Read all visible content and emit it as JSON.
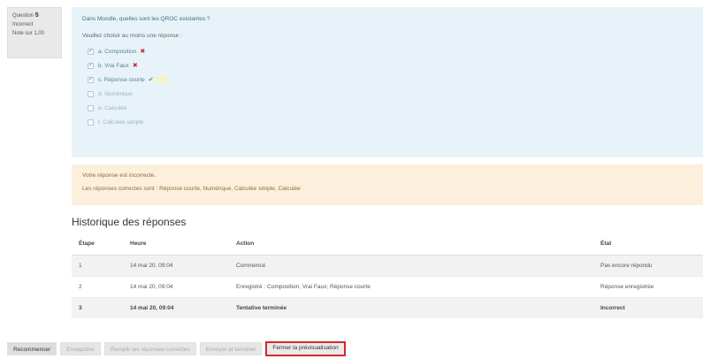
{
  "question_info": {
    "number_label": "Question",
    "number": "5",
    "status": "Incorrect",
    "mark": "Note sur 1,00"
  },
  "formulation": {
    "question_text": "Dans Moodle, quelles sont les QROC existantes ?",
    "prompt": "Veuillez choisir au moins une réponse :",
    "answers": [
      {
        "label": "a. Composition",
        "checked": true,
        "mark": "✖"
      },
      {
        "label": "b. Vrai Faux",
        "checked": true,
        "mark": "✖"
      },
      {
        "label": "c. Réponse courte",
        "checked": true,
        "mark": "✔"
      },
      {
        "label": "d. Numérique",
        "checked": false,
        "mark": ""
      },
      {
        "label": "e. Calculée",
        "checked": false,
        "mark": ""
      },
      {
        "label": "f. Calculée simple",
        "checked": false,
        "mark": ""
      }
    ]
  },
  "feedback": {
    "status": "Votre réponse est incorrecte.",
    "correct": "Les réponses correctes sont : Réponse courte, Numérique, Calculée simple, Calculée"
  },
  "history": {
    "title": "Historique des réponses",
    "headers": [
      "Étape",
      "Heure",
      "Action",
      "État"
    ],
    "rows": [
      [
        "1",
        "14 mai 20, 09:04",
        "Commencé",
        "Pas encore répondu"
      ],
      [
        "2",
        "14 mai 20, 09:04",
        "Enregistré : Composition; Vrai Faux; Réponse courte",
        "Réponse enregistrée"
      ],
      [
        "3",
        "14 mai 20, 09:04",
        "Tentative terminée",
        "Incorrect"
      ]
    ]
  },
  "buttons": {
    "restart": "Recommencer",
    "save": "Enregistrer",
    "fill_correct": "Remplir les réponses correctes",
    "submit_finish": "Envoyer et terminer",
    "close_preview": "Fermer la prévisualisation"
  },
  "colors": {
    "formulation_bg": "#e7f3f9",
    "feedback_bg": "#fcefdc",
    "incorrect_mark": "#c8283a",
    "correct_mark": "#4f8f3a",
    "highlight_border": "#d9262f"
  }
}
